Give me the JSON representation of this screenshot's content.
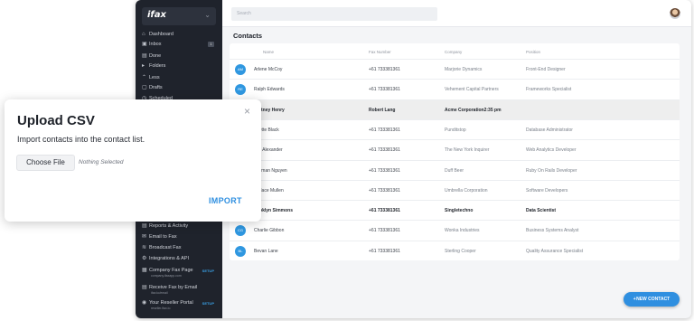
{
  "sidebar": {
    "logo": "ifax",
    "items": [
      {
        "label": "Dashboard",
        "icon": "home-icon",
        "glyph": "⌂"
      },
      {
        "label": "Inbox",
        "icon": "inbox-icon",
        "glyph": "▣",
        "badge": "1"
      },
      {
        "label": "Done",
        "icon": "archive-icon",
        "glyph": "▤"
      },
      {
        "label": "Folders",
        "icon": "folder-icon",
        "glyph": "▸"
      },
      {
        "label": "Less",
        "icon": "chevron-up-icon",
        "glyph": "⌃"
      },
      {
        "label": "Drafts",
        "icon": "draft-icon",
        "glyph": "▢"
      },
      {
        "label": "Scheduled",
        "icon": "clock-icon",
        "glyph": "◷"
      },
      {
        "label": "Reports & Activity",
        "icon": "report-icon",
        "glyph": "▤"
      },
      {
        "label": "Email to Fax",
        "icon": "mail-icon",
        "glyph": "✉"
      },
      {
        "label": "Broadcast Fax",
        "icon": "broadcast-icon",
        "glyph": "≋"
      },
      {
        "label": "Integrations & API",
        "icon": "plug-icon",
        "glyph": "⚙"
      },
      {
        "label": "Company Fax Page",
        "icon": "page-icon",
        "glyph": "▦",
        "sub": "company.ifaxapp.com",
        "setup": "SETUP"
      },
      {
        "label": "Receive Fax by Email",
        "icon": "receive-icon",
        "glyph": "▤",
        "sub": "ifax.to/email"
      },
      {
        "label": "Your Reseller Portal",
        "icon": "portal-icon",
        "glyph": "◉",
        "sub": "reseller.ifax.io",
        "setup": "SETUP"
      }
    ]
  },
  "search": {
    "placeholder": "Search"
  },
  "page": {
    "title": "Contacts"
  },
  "table": {
    "headers": {
      "name": "Name",
      "fax": "Fax Number",
      "company": "Company",
      "position": "Position"
    },
    "rows": [
      {
        "initials": "AM",
        "name": "Arlene McCoy",
        "fax": "+61 733381361",
        "company": "Marjorie Dynamics",
        "position": "Front-End Designer"
      },
      {
        "initials": "RE",
        "name": "Ralph Edwards",
        "fax": "+61 733381361",
        "company": "Vehement Capital Partners",
        "position": "Frameworks Specialist"
      },
      {
        "initials": "",
        "name": "urtney Henry",
        "fax": "Robert Lang",
        "company": "Acme Corporation2:35 pm",
        "position": "",
        "selected": true,
        "bold": true
      },
      {
        "initials": "",
        "name": "nette Black",
        "fax": "+61 733381361",
        "company": "Punditstop",
        "position": "Database Administrator"
      },
      {
        "initials": "",
        "name": "lie Alexander",
        "fax": "+61 733381361",
        "company": "The New York Inquirer",
        "position": "Web Analytics Developer"
      },
      {
        "initials": "",
        "name": "uyman Nguyen",
        "fax": "+61 733381361",
        "company": "Duff Beer",
        "position": "Ruby On Rails Developer"
      },
      {
        "initials": "",
        "name": "ndace Mullen",
        "fax": "+61 733381361",
        "company": "Umbrella Corporation",
        "position": "Software Developers"
      },
      {
        "initials": "",
        "name": "ooklyn Simmons",
        "fax": "+61 733381361",
        "company": "Singletechno",
        "position": "Data Scientist",
        "bold": true
      },
      {
        "initials": "CG",
        "name": "Charlie Gibbon",
        "fax": "+61 733381361",
        "company": "Wonka Industries",
        "position": "Business Systems Analyst"
      },
      {
        "initials": "BL",
        "name": "Bevan Lane",
        "fax": "+61 733381361",
        "company": "Sterling Cooper",
        "position": "Quality Assurance Specialist"
      }
    ]
  },
  "new_contact": {
    "label": "NEW CONTACT",
    "icon": "add-user-icon"
  },
  "modal": {
    "title": "Upload CSV",
    "description": "Import contacts into the contact list.",
    "choose_file": "Choose File",
    "file_status": "Nothing Selected",
    "import": "IMPORT",
    "close_glyph": "×"
  },
  "colors": {
    "accent": "#2f8fe0",
    "sidebar_bg": "#1f232c",
    "avatar_blue": "#2f97e0"
  }
}
